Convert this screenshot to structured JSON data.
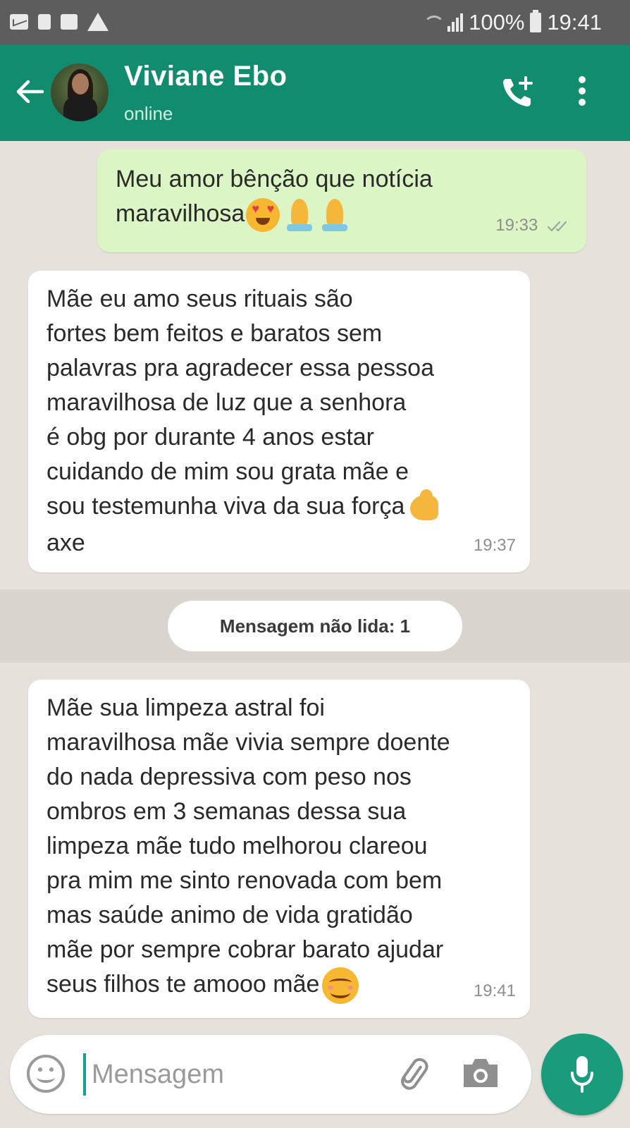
{
  "status_bar": {
    "battery": "100%",
    "time": "19:41"
  },
  "header": {
    "contact_name": "Viviane Ebo",
    "contact_status": "online"
  },
  "messages": [
    {
      "direction": "outgoing",
      "text": "Meu amor bênção que notícia\nmaravilhosa",
      "emojis": [
        "heart-eyes",
        "folded-hands",
        "folded-hands"
      ],
      "time": "19:33",
      "status": "read-double-tick"
    },
    {
      "direction": "incoming",
      "text": "Mãe eu amo seus rituais são\nfortes bem feitos e baratos sem\npalavras pra agradecer essa pessoa\nmaravilhosa de luz que a senhora\né obg por durante 4 anos estar\ncuidando de mim sou grata mãe e\nsou testemunha viva da sua força",
      "emojis": [
        "flexed-biceps"
      ],
      "text_after": "axe",
      "time": "19:37"
    },
    {
      "direction": "incoming",
      "text": "Mãe sua limpeza astral foi\nmaravilhosa mãe vivia sempre doente\ndo nada depressiva com peso nos\nombros em 3 semanas dessa sua\nlimpeza mãe tudo melhorou clareou\npra mim me sinto renovada com bem\nmas saúde animo de vida gratidão\nmãe por sempre cobrar barato ajudar\nseus  filhos te amooo mãe",
      "emojis": [
        "smiling-face"
      ],
      "time": "19:41"
    }
  ],
  "unread_divider": "Mensagem não lida: 1",
  "composer": {
    "placeholder": "Mensagem"
  },
  "colors": {
    "header": "#128c6e",
    "outgoing_bubble": "#dbf6c4",
    "incoming_bubble": "#ffffff",
    "chat_background": "#e6e1da",
    "mic_button": "#1a9c7c"
  }
}
